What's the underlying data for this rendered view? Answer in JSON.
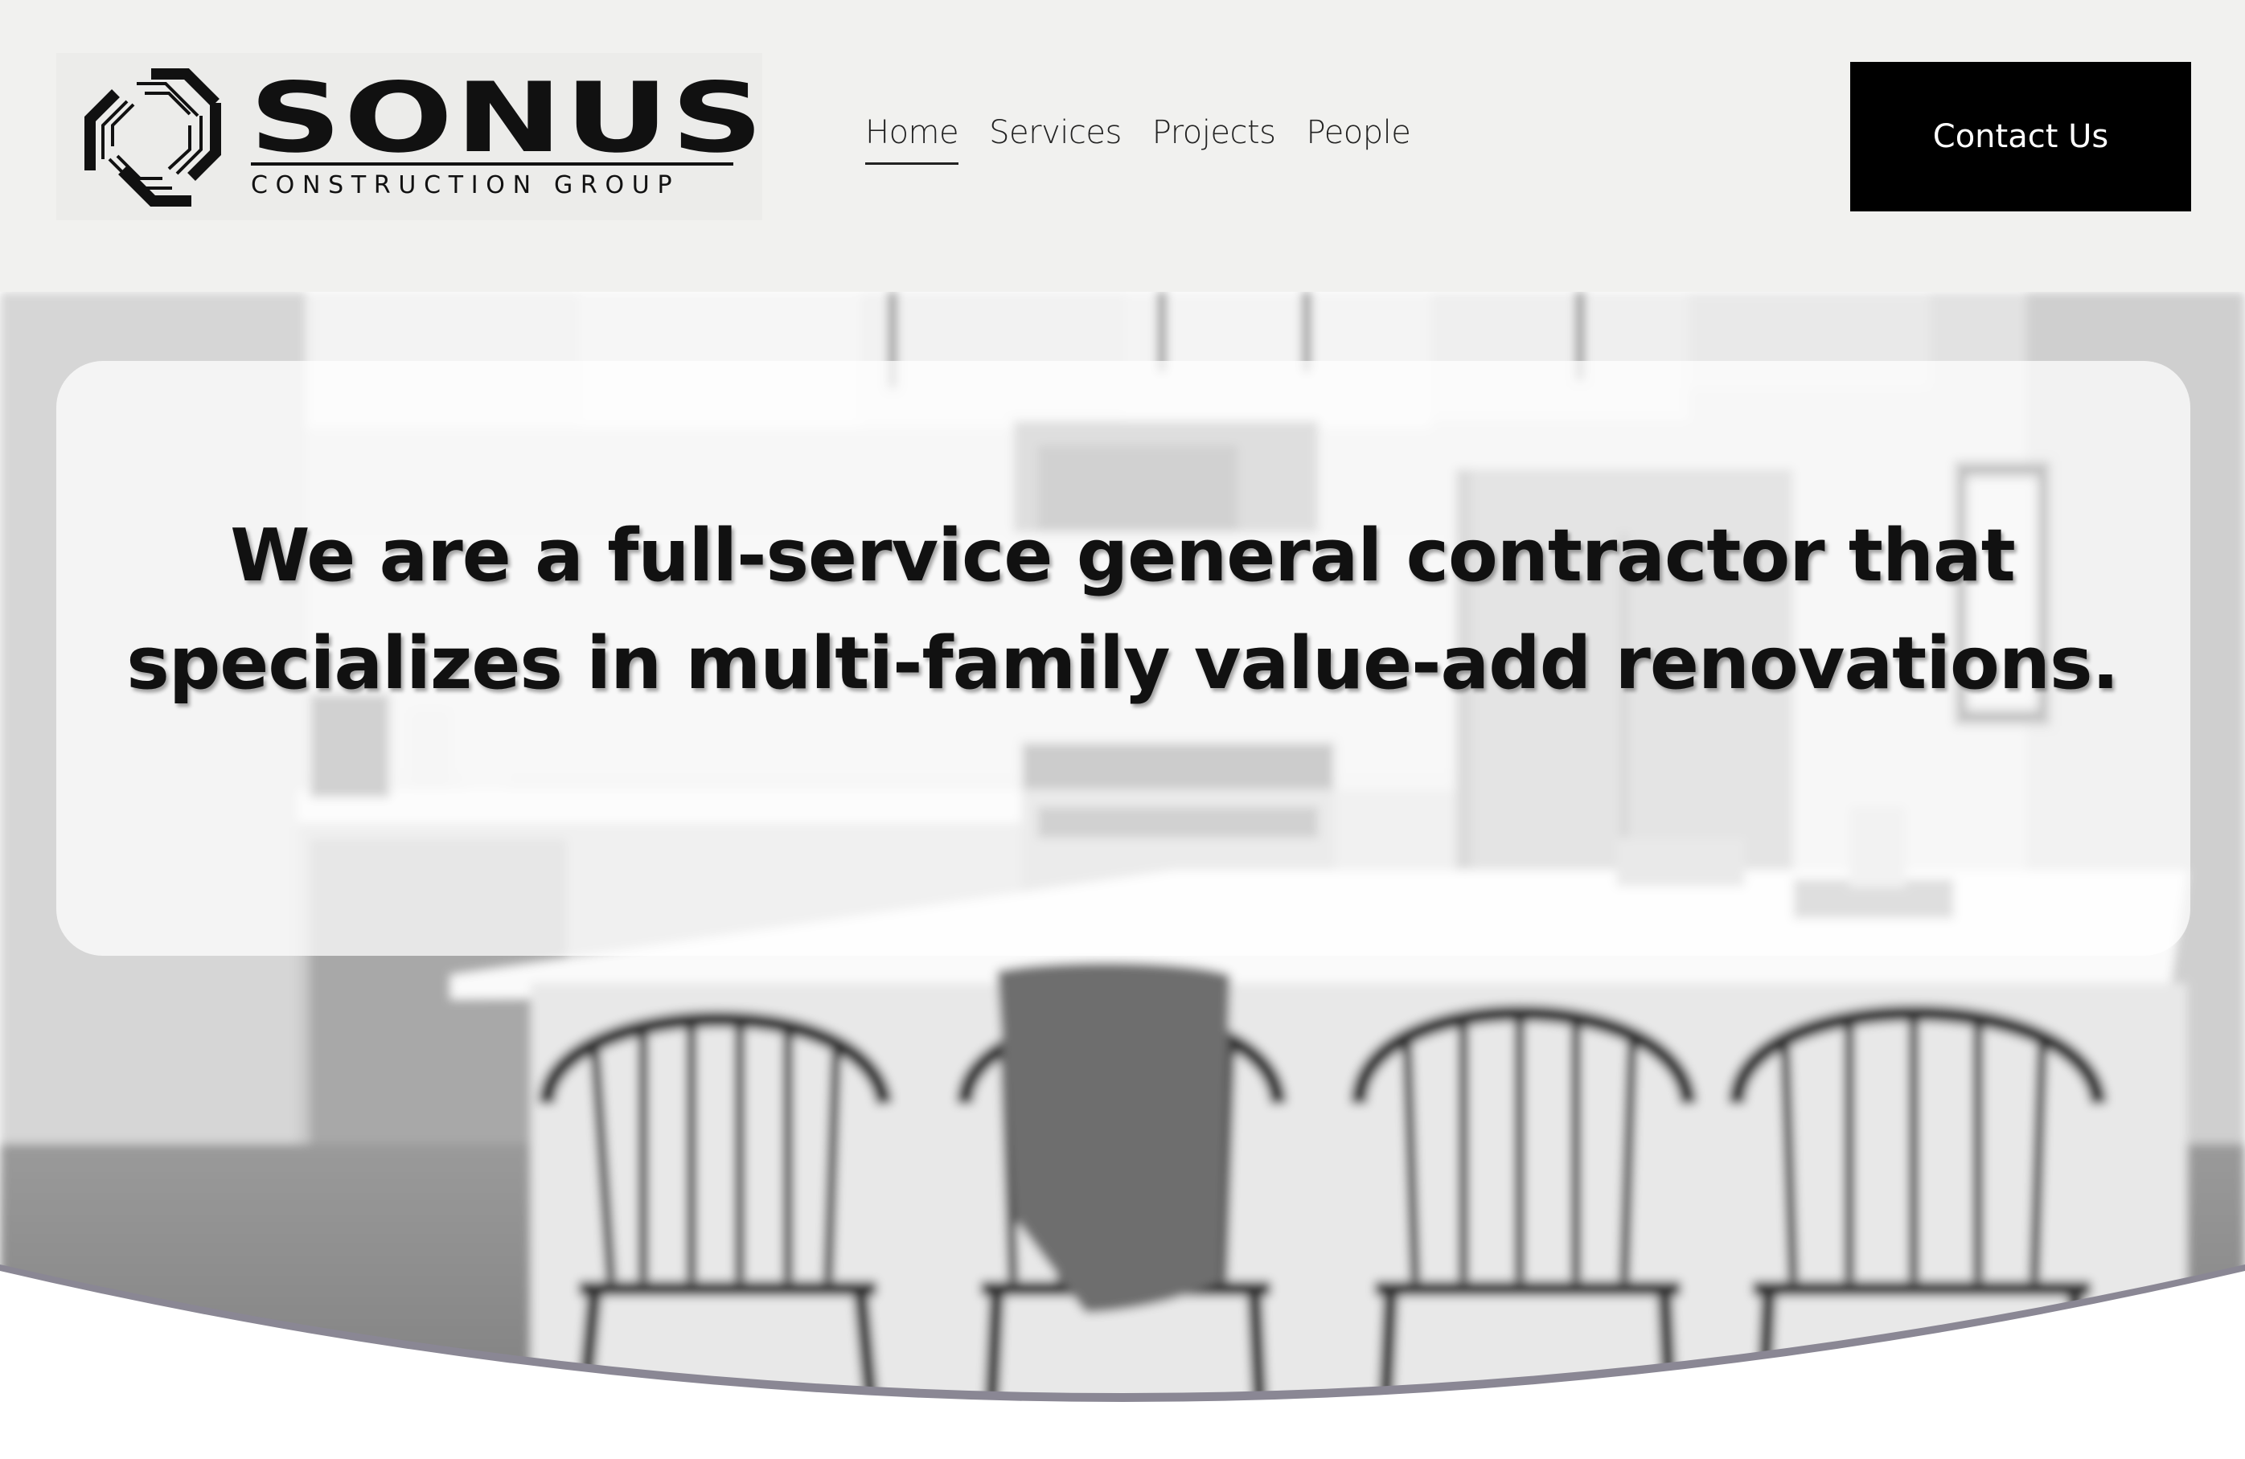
{
  "logo": {
    "brand": "SONUS",
    "tagline": "CONSTRUCTION GROUP"
  },
  "nav": {
    "items": [
      {
        "label": "Home",
        "active": true
      },
      {
        "label": "Services",
        "active": false
      },
      {
        "label": "Projects",
        "active": false
      },
      {
        "label": "People",
        "active": false
      }
    ]
  },
  "header": {
    "cta_label": "Contact Us"
  },
  "hero": {
    "headline_line1": "We are a full-service general contractor that",
    "headline_line2": "specializes in multi-family value-add renovations."
  },
  "colors": {
    "header_bg": "#f1f1ef",
    "cta_bg": "#000000",
    "cta_text": "#ffffff",
    "wave": "#8a8794"
  }
}
